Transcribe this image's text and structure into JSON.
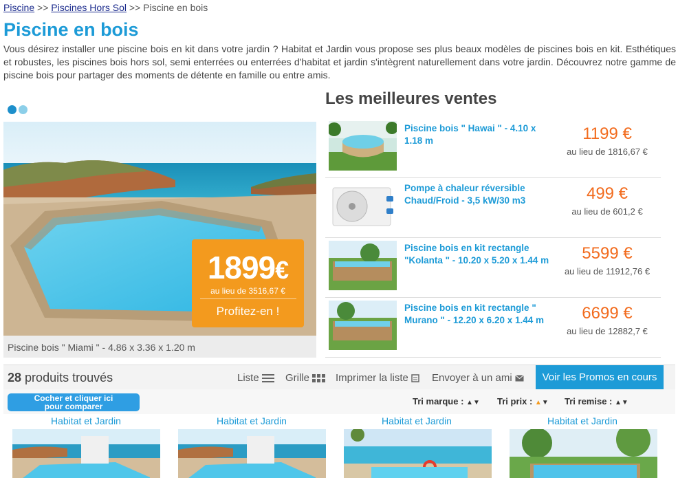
{
  "breadcrumb": {
    "items": [
      "Piscine",
      "Piscines Hors Sol",
      "Piscine en bois"
    ],
    "separator": ">>"
  },
  "title": "Piscine en bois",
  "intro": "Vous désirez installer une piscine bois en kit dans votre jardin ? Habitat et Jardin vous propose ses plus beaux modèles de piscines bois en kit. Esthétiques et robustes, les piscines bois hors sol, semi enterrées ou enterrées d'habitat et jardin s'intègrent naturellement dans votre jardin. Découvrez notre gamme de piscine bois pour partager des moments de détente en famille ou entre amis.",
  "hero": {
    "price": "1899",
    "currency": "€",
    "was": "au lieu de 3516,67 €",
    "cta": "Profitez-en !",
    "caption": "Piscine bois \" Miami \" - 4.86 x 3.36 x 1.20 m"
  },
  "best_sellers": {
    "title": "Les meilleures ventes",
    "items": [
      {
        "name": "Piscine bois \" Hawai \" - 4.10 x 1.18 m",
        "price": "1199 €",
        "was": "au lieu de 1816,67 €"
      },
      {
        "name": "Pompe à chaleur réversible Chaud/Froid - 3,5 kW/30 m3",
        "price": "499 €",
        "was": "au lieu de 601,2 €"
      },
      {
        "name": "Piscine bois en kit rectangle \"Kolanta \" - 10.20 x 5.20 x 1.44 m",
        "price": "5599 €",
        "was": "au lieu de 11912,76 €"
      },
      {
        "name": "Piscine bois en kit rectangle \" Murano \" - 12.20 x 6.20 x 1.44 m",
        "price": "6699 €",
        "was": "au lieu de 12882,7 €"
      }
    ]
  },
  "results": {
    "count": "28",
    "count_label": "produits trouvés",
    "list": "Liste",
    "grid": "Grille",
    "print": "Imprimer la liste",
    "email": "Envoyer à un ami",
    "promos": "Voir les Promos en cours"
  },
  "sort": {
    "compare_line1": "Cocher et cliquer ici",
    "compare_line2": "pour comparer",
    "brand": "Tri marque :",
    "price": "Tri prix :",
    "discount": "Tri remise :"
  },
  "cards": [
    {
      "brand": "Habitat et Jardin"
    },
    {
      "brand": "Habitat et Jardin"
    },
    {
      "brand": "Habitat et Jardin"
    },
    {
      "brand": "Habitat et Jardin"
    }
  ],
  "colors": {
    "accent_blue": "#1d9bd7",
    "price_orange": "#f26b1d",
    "promo_orange": "#f39a1e"
  }
}
